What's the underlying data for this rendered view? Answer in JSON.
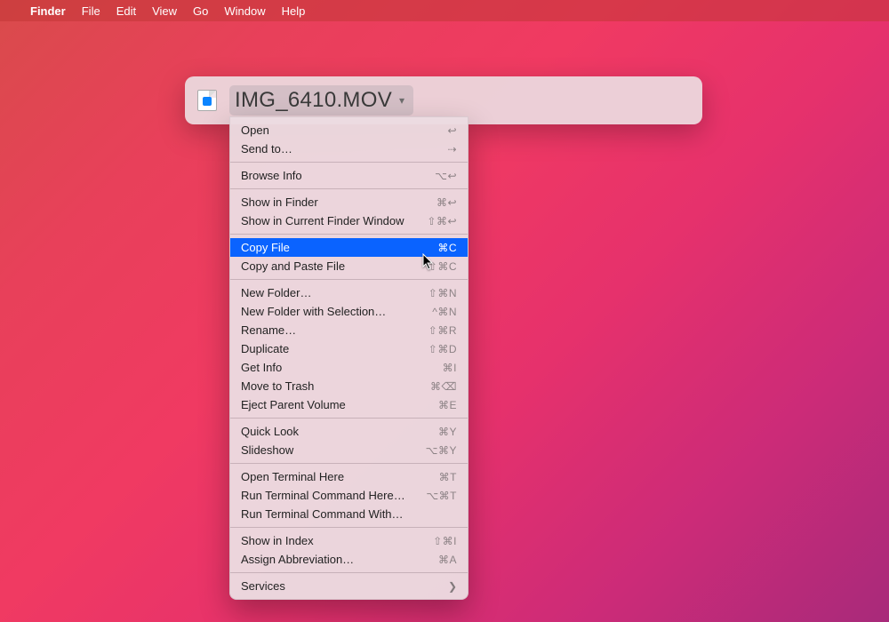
{
  "menubar": {
    "apple": "",
    "app": "Finder",
    "items": [
      "File",
      "Edit",
      "View",
      "Go",
      "Window",
      "Help"
    ]
  },
  "spotlight": {
    "filename": "IMG_6410.MOV"
  },
  "contextMenu": {
    "sections": [
      [
        {
          "label": "Open",
          "shortcut": "↩"
        },
        {
          "label": "Send to…",
          "shortcut": "⇢"
        }
      ],
      [
        {
          "label": "Browse Info",
          "shortcut": "⌥↩"
        }
      ],
      [
        {
          "label": "Show in Finder",
          "shortcut": "⌘↩"
        },
        {
          "label": "Show in Current Finder Window",
          "shortcut": "⇧⌘↩"
        }
      ],
      [
        {
          "label": "Copy File",
          "shortcut": "⌘C",
          "highlight": true
        },
        {
          "label": "Copy and Paste File",
          "shortcut": "⇧⌘C"
        }
      ],
      [
        {
          "label": "New Folder…",
          "shortcut": "⇧⌘N"
        },
        {
          "label": "New Folder with Selection…",
          "shortcut": "^⌘N"
        },
        {
          "label": "Rename…",
          "shortcut": "⇧⌘R"
        },
        {
          "label": "Duplicate",
          "shortcut": "⇧⌘D"
        },
        {
          "label": "Get Info",
          "shortcut": "⌘I"
        },
        {
          "label": "Move to Trash",
          "shortcut": "⌘⌫"
        },
        {
          "label": "Eject Parent Volume",
          "shortcut": "⌘E"
        }
      ],
      [
        {
          "label": "Quick Look",
          "shortcut": "⌘Y"
        },
        {
          "label": "Slideshow",
          "shortcut": "⌥⌘Y"
        }
      ],
      [
        {
          "label": "Open Terminal Here",
          "shortcut": "⌘T"
        },
        {
          "label": "Run Terminal Command Here…",
          "shortcut": "⌥⌘T"
        },
        {
          "label": "Run Terminal Command With…",
          "shortcut": ""
        }
      ],
      [
        {
          "label": "Show in Index",
          "shortcut": "⇧⌘I"
        },
        {
          "label": "Assign Abbreviation…",
          "shortcut": "⌘A"
        }
      ],
      [
        {
          "label": "Services",
          "shortcut": "❯",
          "submenu": true
        }
      ]
    ]
  }
}
